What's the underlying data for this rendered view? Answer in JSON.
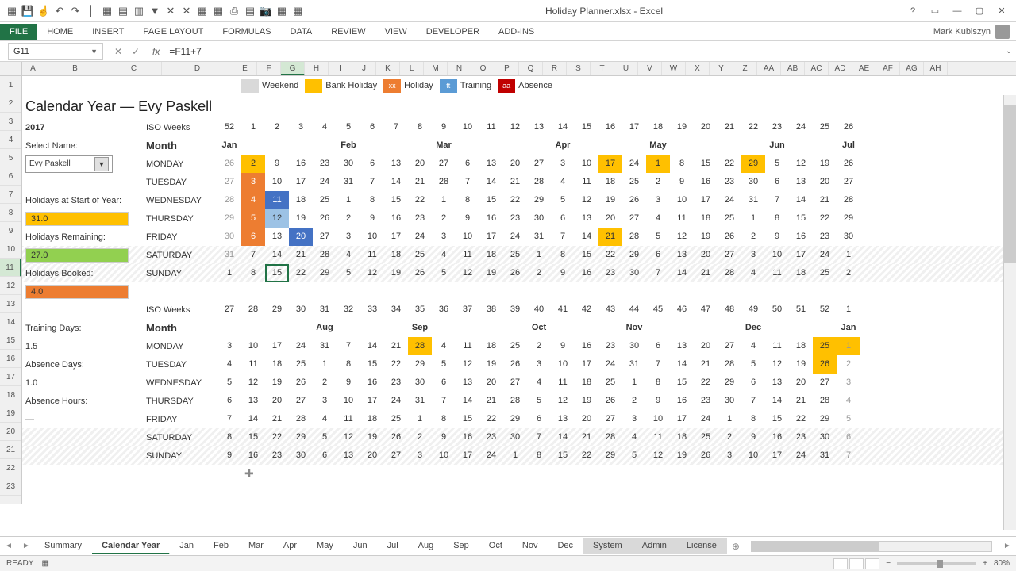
{
  "titlebar": {
    "filename": "Holiday Planner.xlsx - Excel"
  },
  "ribbon": {
    "tabs": [
      "FILE",
      "HOME",
      "INSERT",
      "PAGE LAYOUT",
      "FORMULAS",
      "DATA",
      "REVIEW",
      "VIEW",
      "DEVELOPER",
      "ADD-INS"
    ],
    "account_name": "Mark Kubiszyn"
  },
  "formula": {
    "name_box": "G11",
    "value": "=F11+7"
  },
  "columns": [
    "A",
    "B",
    "C",
    "D",
    "E",
    "F",
    "G",
    "H",
    "I",
    "J",
    "K",
    "L",
    "M",
    "N",
    "O",
    "P",
    "Q",
    "R",
    "S",
    "T",
    "U",
    "V",
    "W",
    "X",
    "Y",
    "Z",
    "AA",
    "AB",
    "AC",
    "AD",
    "AE",
    "AF",
    "AG",
    "AH"
  ],
  "rows": [
    "1",
    "2",
    "3",
    "4",
    "5",
    "6",
    "7",
    "8",
    "9",
    "10",
    "11",
    "12",
    "13",
    "14",
    "15",
    "16",
    "17",
    "18",
    "19",
    "20",
    "21",
    "22",
    "23"
  ],
  "active_col": "G",
  "active_row": "11",
  "legend": {
    "weekend": "Weekend",
    "bank_holiday": "Bank Holiday",
    "holiday": "Holiday",
    "training": "Training",
    "absence": "Absence",
    "xx": "xx",
    "tt": "tt",
    "aa": "aa"
  },
  "header": {
    "title": "Calendar Year — Evy Paskell",
    "year": "2017",
    "iso_label": "ISO Weeks",
    "month_label": "Month"
  },
  "select": {
    "label": "Select Name:",
    "value": "Evy Paskell"
  },
  "summary": {
    "hol_start_lbl": "Holidays at Start of Year:",
    "hol_start": "31.0",
    "hol_rem_lbl": "Holidays Remaining:",
    "hol_rem": "27.0",
    "hol_booked_lbl": "Holidays Booked:",
    "hol_booked": "4.0",
    "train_lbl": "Training Days:",
    "train": "1.5",
    "abs_lbl": "Absence Days:",
    "abs": "1.0",
    "absh_lbl": "Absence Hours:",
    "absh": "—"
  },
  "days": [
    "MONDAY",
    "TUESDAY",
    "WEDNESDAY",
    "THURSDAY",
    "FRIDAY",
    "SATURDAY",
    "SUNDAY"
  ],
  "months_top": {
    "jan": "Jan",
    "feb": "Feb",
    "mar": "Mar",
    "apr": "Apr",
    "may": "May",
    "jun": "Jun",
    "jul": "Jul"
  },
  "months_bot": {
    "aug": "Aug",
    "sep": "Sep",
    "oct": "Oct",
    "nov": "Nov",
    "dec": "Dec",
    "jan": "Jan"
  },
  "iso_top": [
    "52",
    "1",
    "2",
    "3",
    "4",
    "5",
    "6",
    "7",
    "8",
    "9",
    "10",
    "11",
    "12",
    "13",
    "14",
    "15",
    "16",
    "17",
    "18",
    "19",
    "20",
    "21",
    "22",
    "23",
    "24",
    "25",
    "26"
  ],
  "iso_bot": [
    "27",
    "28",
    "29",
    "30",
    "31",
    "32",
    "33",
    "34",
    "35",
    "36",
    "37",
    "38",
    "39",
    "40",
    "41",
    "42",
    "43",
    "44",
    "45",
    "46",
    "47",
    "48",
    "49",
    "50",
    "51",
    "52",
    "1"
  ],
  "cal_top": {
    "mon": [
      "26",
      "2",
      "9",
      "16",
      "23",
      "30",
      "6",
      "13",
      "20",
      "27",
      "6",
      "13",
      "20",
      "27",
      "3",
      "10",
      "17",
      "24",
      "1",
      "8",
      "15",
      "22",
      "29",
      "5",
      "12",
      "19",
      "26"
    ],
    "tue": [
      "27",
      "3",
      "10",
      "17",
      "24",
      "31",
      "7",
      "14",
      "21",
      "28",
      "7",
      "14",
      "21",
      "28",
      "4",
      "11",
      "18",
      "25",
      "2",
      "9",
      "16",
      "23",
      "30",
      "6",
      "13",
      "20",
      "27"
    ],
    "wed": [
      "28",
      "4",
      "11",
      "18",
      "25",
      "1",
      "8",
      "15",
      "22",
      "1",
      "8",
      "15",
      "22",
      "29",
      "5",
      "12",
      "19",
      "26",
      "3",
      "10",
      "17",
      "24",
      "31",
      "7",
      "14",
      "21",
      "28"
    ],
    "thu": [
      "29",
      "5",
      "12",
      "19",
      "26",
      "2",
      "9",
      "16",
      "23",
      "2",
      "9",
      "16",
      "23",
      "30",
      "6",
      "13",
      "20",
      "27",
      "4",
      "11",
      "18",
      "25",
      "1",
      "8",
      "15",
      "22",
      "29"
    ],
    "fri": [
      "30",
      "6",
      "13",
      "20",
      "27",
      "3",
      "10",
      "17",
      "24",
      "3",
      "10",
      "17",
      "24",
      "31",
      "7",
      "14",
      "21",
      "28",
      "5",
      "12",
      "19",
      "26",
      "2",
      "9",
      "16",
      "23",
      "30"
    ],
    "sat": [
      "31",
      "7",
      "14",
      "21",
      "28",
      "4",
      "11",
      "18",
      "25",
      "4",
      "11",
      "18",
      "25",
      "1",
      "8",
      "15",
      "22",
      "29",
      "6",
      "13",
      "20",
      "27",
      "3",
      "10",
      "17",
      "24",
      "1"
    ],
    "sun": [
      "1",
      "8",
      "15",
      "22",
      "29",
      "5",
      "12",
      "19",
      "26",
      "5",
      "12",
      "19",
      "26",
      "2",
      "9",
      "16",
      "23",
      "30",
      "7",
      "14",
      "21",
      "28",
      "4",
      "11",
      "18",
      "25",
      "2"
    ]
  },
  "cal_bot": {
    "mon": [
      "3",
      "10",
      "17",
      "24",
      "31",
      "7",
      "14",
      "21",
      "28",
      "4",
      "11",
      "18",
      "25",
      "2",
      "9",
      "16",
      "23",
      "30",
      "6",
      "13",
      "20",
      "27",
      "4",
      "11",
      "18",
      "25",
      "1"
    ],
    "tue": [
      "4",
      "11",
      "18",
      "25",
      "1",
      "8",
      "15",
      "22",
      "29",
      "5",
      "12",
      "19",
      "26",
      "3",
      "10",
      "17",
      "24",
      "31",
      "7",
      "14",
      "21",
      "28",
      "5",
      "12",
      "19",
      "26",
      "2"
    ],
    "wed": [
      "5",
      "12",
      "19",
      "26",
      "2",
      "9",
      "16",
      "23",
      "30",
      "6",
      "13",
      "20",
      "27",
      "4",
      "11",
      "18",
      "25",
      "1",
      "8",
      "15",
      "22",
      "29",
      "6",
      "13",
      "20",
      "27",
      "3"
    ],
    "thu": [
      "6",
      "13",
      "20",
      "27",
      "3",
      "10",
      "17",
      "24",
      "31",
      "7",
      "14",
      "21",
      "28",
      "5",
      "12",
      "19",
      "26",
      "2",
      "9",
      "16",
      "23",
      "30",
      "7",
      "14",
      "21",
      "28",
      "4"
    ],
    "fri": [
      "7",
      "14",
      "21",
      "28",
      "4",
      "11",
      "18",
      "25",
      "1",
      "8",
      "15",
      "22",
      "29",
      "6",
      "13",
      "20",
      "27",
      "3",
      "10",
      "17",
      "24",
      "1",
      "8",
      "15",
      "22",
      "29",
      "5"
    ],
    "sat": [
      "8",
      "15",
      "22",
      "29",
      "5",
      "12",
      "19",
      "26",
      "2",
      "9",
      "16",
      "23",
      "30",
      "7",
      "14",
      "21",
      "28",
      "4",
      "11",
      "18",
      "25",
      "2",
      "9",
      "16",
      "23",
      "30",
      "6"
    ],
    "sun": [
      "9",
      "16",
      "23",
      "30",
      "6",
      "13",
      "20",
      "27",
      "3",
      "10",
      "17",
      "24",
      "1",
      "8",
      "15",
      "22",
      "29",
      "5",
      "12",
      "19",
      "26",
      "3",
      "10",
      "17",
      "24",
      "31",
      "7"
    ]
  },
  "sheet_tabs": [
    "Summary",
    "Calendar Year",
    "Jan",
    "Feb",
    "Mar",
    "Apr",
    "May",
    "Jun",
    "Jul",
    "Aug",
    "Sep",
    "Oct",
    "Nov",
    "Dec",
    "System",
    "Admin",
    "License"
  ],
  "active_sheet": "Calendar Year",
  "status": {
    "ready": "READY",
    "zoom": "80%"
  }
}
